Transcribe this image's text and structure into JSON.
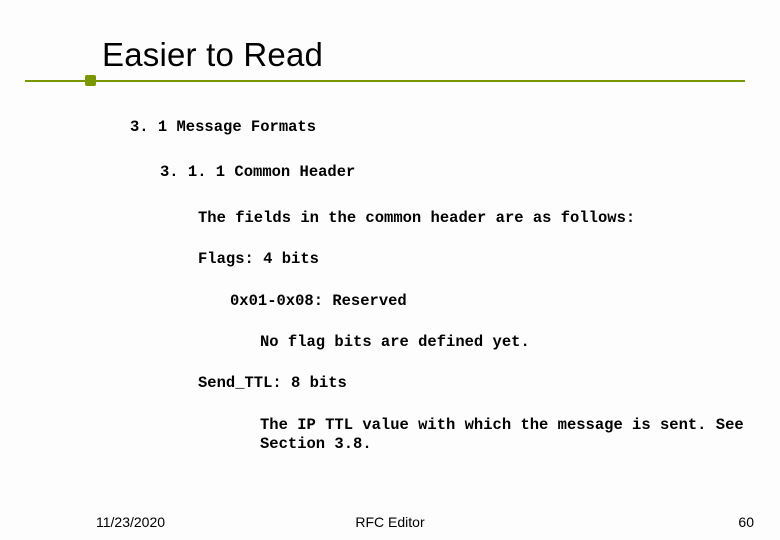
{
  "title": "Easier to Read",
  "sections": {
    "h1": "3. 1 Message Formats",
    "h2": "3. 1. 1 Common Header",
    "intro": "The fields in the common header are as follows:",
    "flags_label": "Flags: 4 bits",
    "flags_reserved": "0x01-0x08: Reserved",
    "flags_note": "No flag bits are defined yet.",
    "send_ttl_label": "Send_TTL: 8 bits",
    "send_ttl_desc": "The IP TTL value with which the message is sent. See Section 3.8."
  },
  "footer": {
    "date": "11/23/2020",
    "center": "RFC Editor",
    "page": "60"
  }
}
